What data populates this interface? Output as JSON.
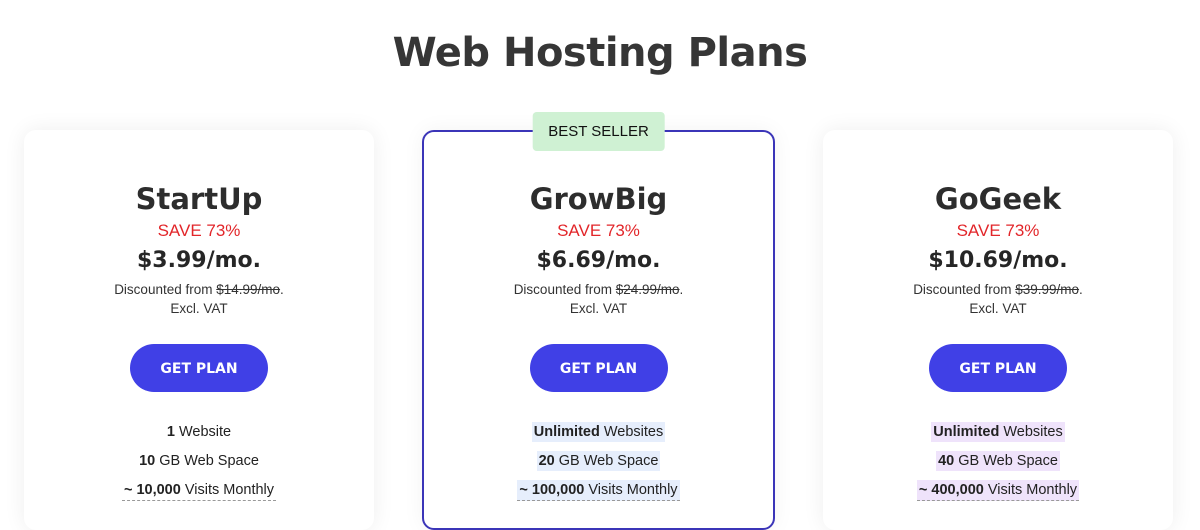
{
  "page": {
    "title": "Web Hosting Plans"
  },
  "plans": [
    {
      "name": "StartUp",
      "save": "SAVE 73%",
      "price": "$3.99/mo.",
      "discounted_prefix": "Discounted from",
      "original_price": "$14.99/mo",
      "discounted_suffix": ".",
      "vat": "Excl. VAT",
      "button": "GET PLAN",
      "features": [
        {
          "bold": "1",
          "text": " Website"
        },
        {
          "bold": "10",
          "text": " GB Web Space"
        },
        {
          "bold": "~ 10,000",
          "text": " Visits Monthly"
        }
      ]
    },
    {
      "badge": "BEST SELLER",
      "name": "GrowBig",
      "save": "SAVE 73%",
      "price": "$6.69/mo.",
      "discounted_prefix": "Discounted from",
      "original_price": "$24.99/mo",
      "discounted_suffix": ".",
      "vat": "Excl. VAT",
      "button": "GET PLAN",
      "features": [
        {
          "bold": "Unlimited",
          "text": " Websites"
        },
        {
          "bold": "20",
          "text": " GB Web Space"
        },
        {
          "bold": "~ 100,000",
          "text": " Visits Monthly"
        }
      ]
    },
    {
      "name": "GoGeek",
      "save": "SAVE 73%",
      "price": "$10.69/mo.",
      "discounted_prefix": "Discounted from",
      "original_price": "$39.99/mo",
      "discounted_suffix": ".",
      "vat": "Excl. VAT",
      "button": "GET PLAN",
      "features": [
        {
          "bold": "Unlimited",
          "text": " Websites"
        },
        {
          "bold": "40",
          "text": " GB Web Space"
        },
        {
          "bold": "~ 400,000",
          "text": " Visits Monthly"
        }
      ]
    }
  ],
  "colors": {
    "accent": "#4040e6",
    "save": "#e2262a",
    "badge": "#cff1d3",
    "featured_border": "#3b35b8"
  }
}
